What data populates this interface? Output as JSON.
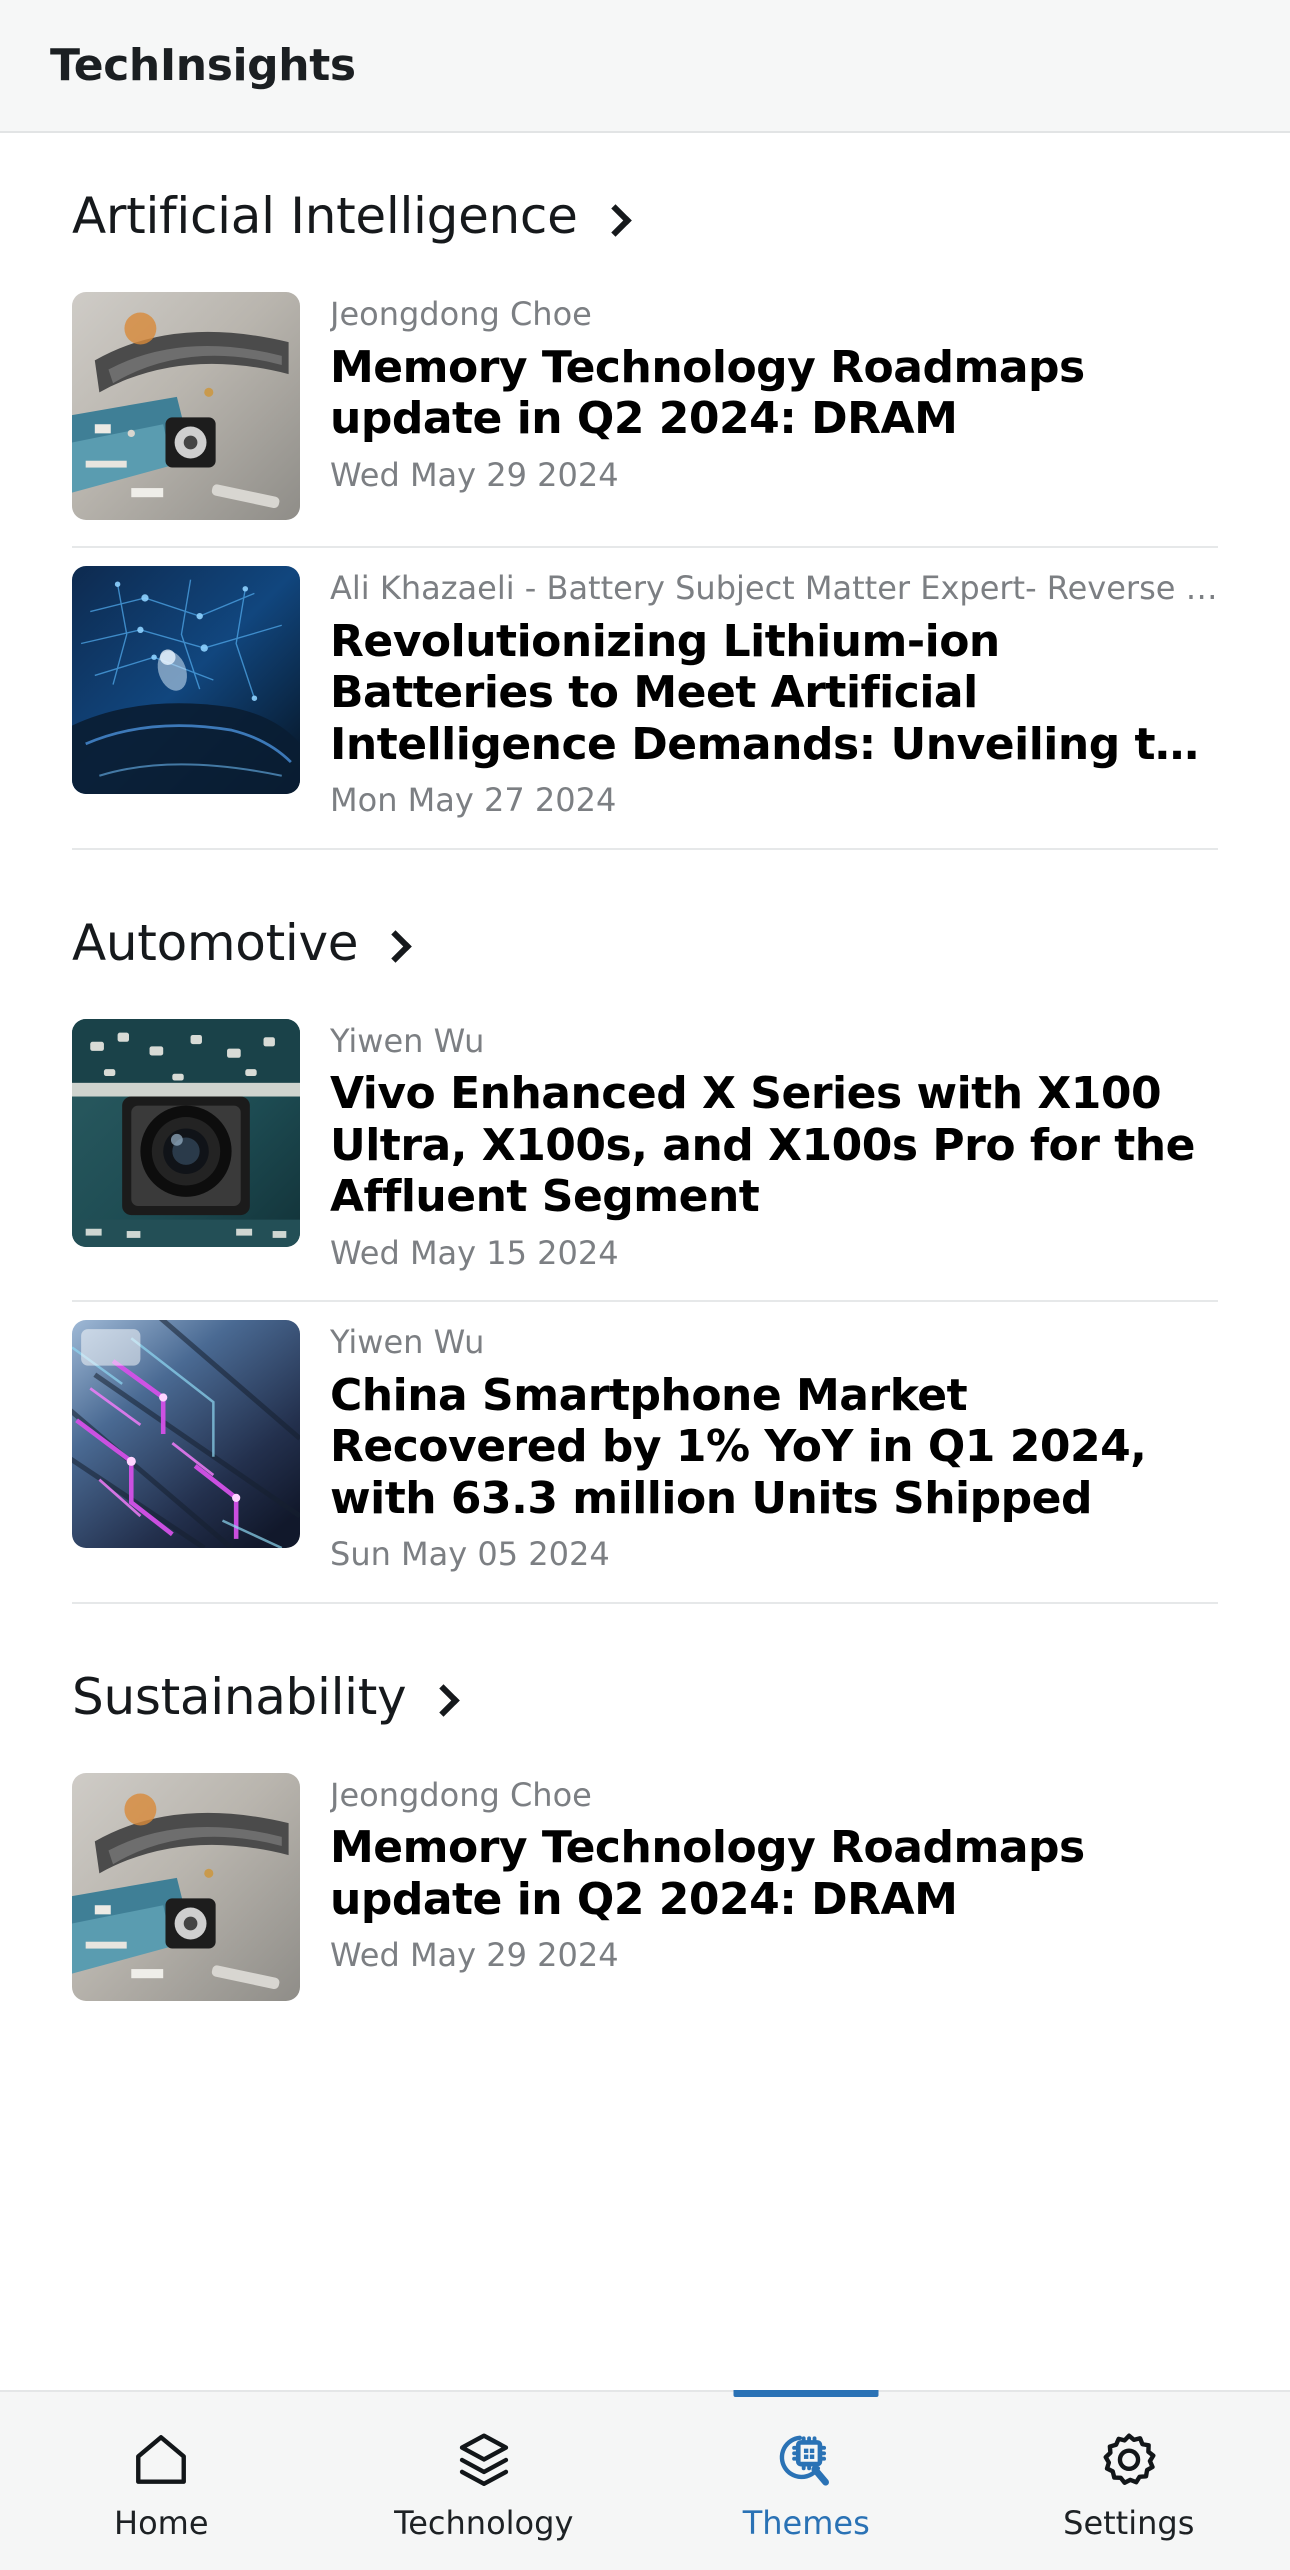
{
  "app": {
    "title": "TechInsights"
  },
  "sections": [
    {
      "title": "Artificial Intelligence",
      "chevron_icon": "chevron-right-icon",
      "articles": [
        {
          "author": "Jeongdong Choe",
          "title": "Memory Technology Roadmaps update in Q2 2024: DRAM",
          "date": "Wed May 29 2024",
          "thumb": "teardown-pcb-photo"
        },
        {
          "author": "Ali Khazaeli - Battery Subject Matter Expert- Reverse En…",
          "title": "Revolutionizing Lithium-ion Batteries to Meet Artificial Intelligence Demands: Unveiling t…",
          "date": "Mon May 27 2024",
          "thumb": "blue-ev-network-photo"
        }
      ]
    },
    {
      "title": "Automotive",
      "chevron_icon": "chevron-right-icon",
      "articles": [
        {
          "author": "Yiwen Wu",
          "title": "Vivo Enhanced X Series with X100 Ultra, X100s, and X100s Pro for the Affluent Segment",
          "date": "Wed May 15 2024",
          "thumb": "camera-module-pcb-photo"
        },
        {
          "author": "Yiwen Wu",
          "title": "China Smartphone Market Recovered by 1% YoY in Q1 2024, with 63.3 million Units Shipped",
          "date": "Sun May 05 2024",
          "thumb": "purple-circuit-traces-photo"
        }
      ]
    },
    {
      "title": "Sustainability",
      "chevron_icon": "chevron-right-icon",
      "articles": [
        {
          "author": "Jeongdong Choe",
          "title": "Memory Technology Roadmaps update in Q2 2024: DRAM",
          "date": "Wed May 29 2024",
          "thumb": "teardown-pcb-photo"
        }
      ]
    }
  ],
  "bottom_nav": {
    "active_color": "#2a72b5",
    "items": [
      {
        "label": "Home",
        "icon": "home-icon",
        "active": false
      },
      {
        "label": "Technology",
        "icon": "layers-icon",
        "active": false
      },
      {
        "label": "Themes",
        "icon": "chip-search-icon",
        "active": true
      },
      {
        "label": "Settings",
        "icon": "gear-icon",
        "active": false
      }
    ]
  }
}
